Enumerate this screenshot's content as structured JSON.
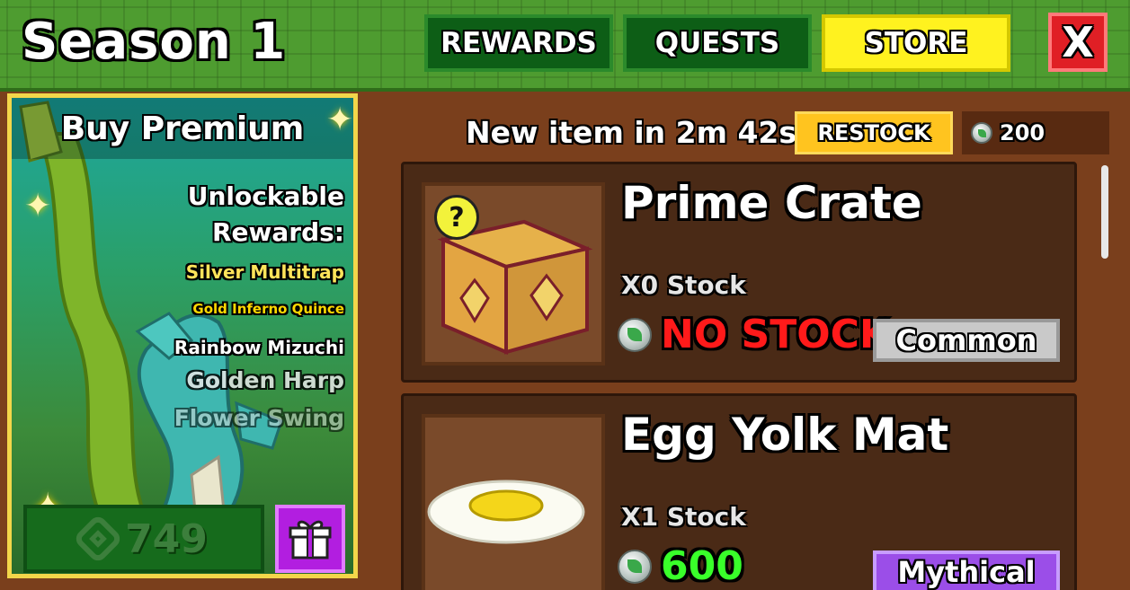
{
  "header": {
    "season_title": "Season 1",
    "tabs": [
      {
        "label": "REWARDS"
      },
      {
        "label": "QUESTS"
      },
      {
        "label": "STORE"
      }
    ],
    "close_label": "X"
  },
  "premium": {
    "title": "Buy Premium",
    "unlockable_line1": "Unlockable",
    "unlockable_line2": "Rewards:",
    "rewards": [
      "Silver Multitrap",
      "Gold Inferno Quince",
      "Rainbow Mizuchi",
      "Golden Harp",
      "Flower Swing"
    ],
    "price": "749",
    "currency_icon": "robux-icon",
    "gift_icon": "gift-icon"
  },
  "store": {
    "restock_timer": "New item in 2m 42s",
    "restock_label": "RESTOCK",
    "balance": "200",
    "items": [
      {
        "name": "Prime Crate",
        "stock": "X0 Stock",
        "price": "NO STOCK",
        "price_color": "#ff1a1a",
        "rarity": "Common",
        "info_badge": "?"
      },
      {
        "name": "Egg Yolk Mat",
        "stock": "X1 Stock",
        "price": "600",
        "price_color": "#39ff2a",
        "rarity": "Mythical"
      }
    ]
  },
  "colors": {
    "top_bar": "#4e9c30",
    "tab_active": "#fff21f",
    "tab_inactive": "#0d5e16",
    "close": "#e01f25",
    "restock": "#ffc41f",
    "common": "#c9c9c9",
    "mythical": "#9b4ee8"
  }
}
